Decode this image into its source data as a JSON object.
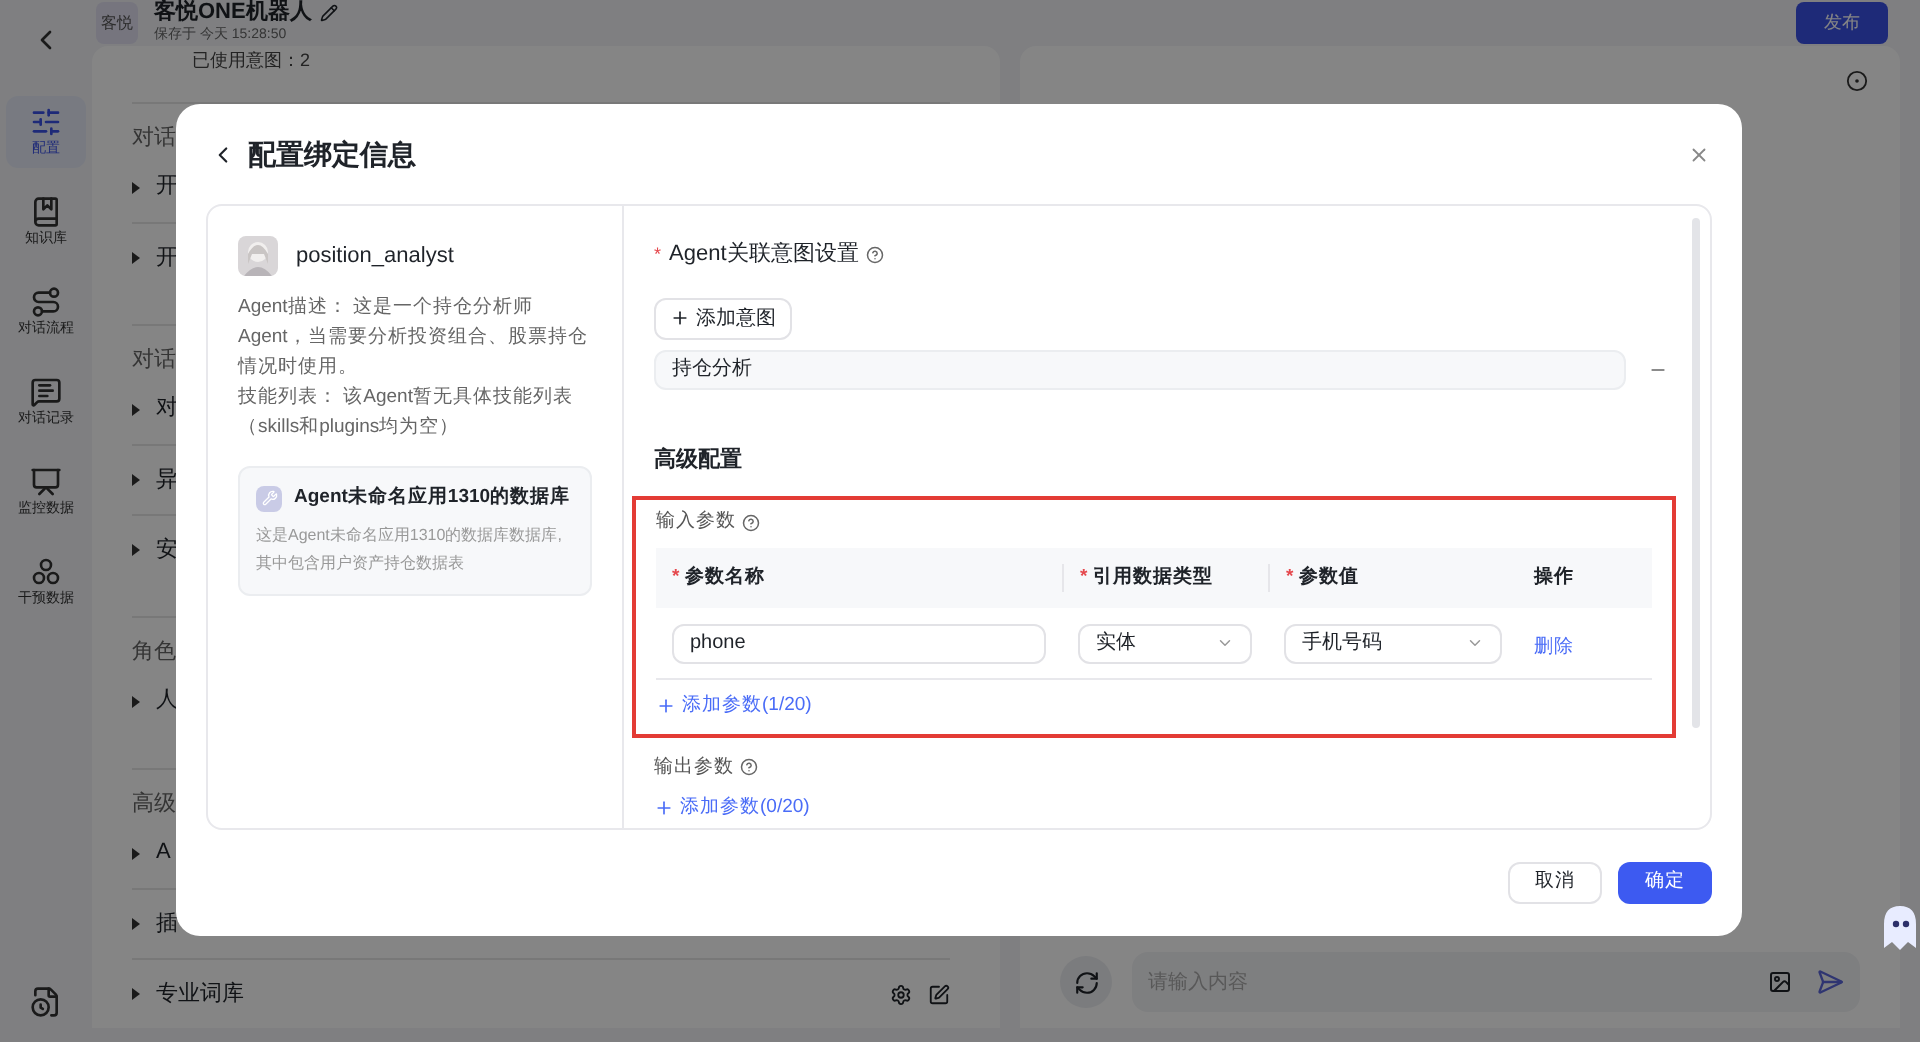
{
  "header": {
    "logo": "客悦",
    "title": "客悦ONE机器人",
    "saved": "保存于 今天 15:28:50",
    "publish": "发布"
  },
  "nav": [
    {
      "label": "配置",
      "kind": "sliders",
      "selected": true
    },
    {
      "label": "知识库",
      "kind": "book",
      "selected": false
    },
    {
      "label": "对话流程",
      "kind": "flow",
      "selected": false
    },
    {
      "label": "对话记录",
      "kind": "chat",
      "selected": false
    },
    {
      "label": "监控数据",
      "kind": "monitor",
      "selected": false
    },
    {
      "label": "干预数据",
      "kind": "nodes",
      "selected": false
    }
  ],
  "config_panel": {
    "intent_note": "已使用意图：2",
    "sections": [
      {
        "title": "对话",
        "items": [
          {
            "label": "开"
          },
          {
            "label": "开"
          }
        ]
      },
      {
        "title": "对话",
        "items": [
          {
            "label": "对"
          },
          {
            "label": "异"
          },
          {
            "label": "安"
          }
        ]
      },
      {
        "title": "角色",
        "items": [
          {
            "label": "人"
          }
        ]
      },
      {
        "title": "高级",
        "items": [
          {
            "label": "A"
          },
          {
            "label": "插"
          },
          {
            "label": "专业词库",
            "tools": true
          }
        ]
      }
    ]
  },
  "chat": {
    "placeholder": "请输入内容"
  },
  "dialog": {
    "title": "配置绑定信息",
    "agent": {
      "name": "position_analyst",
      "description": "Agent描述： 这是一个持仓分析师Agent，当需要分析投资组合、股票持仓情况时使用。",
      "skills": "技能列表： 该Agent暂无具体技能列表（skills和plugins均为空）"
    },
    "database": {
      "title": "Agent未命名应用1310的数据库",
      "description": "这是Agent未命名应用1310的数据库数据库, 其中包含用户资产持仓数据表"
    },
    "required_mark": "*",
    "intent_label": "Agent关联意图设置",
    "add_intent": "添加意图",
    "intents": [
      "持仓分析"
    ],
    "advanced_title": "高级配置",
    "input_label": "输入参数",
    "columns": [
      {
        "label": "参数名称",
        "required": true
      },
      {
        "label": "引用数据类型",
        "required": true
      },
      {
        "label": "参数值",
        "required": true
      },
      {
        "label": "操作",
        "required": false
      }
    ],
    "rows": [
      {
        "name": "phone",
        "type": "实体",
        "value": "手机号码",
        "action": "删除"
      }
    ],
    "add_input": "添加参数(1/20)",
    "output_label": "输出参数",
    "add_output": "添加参数(0/20)",
    "cancel": "取消",
    "ok": "确定"
  }
}
